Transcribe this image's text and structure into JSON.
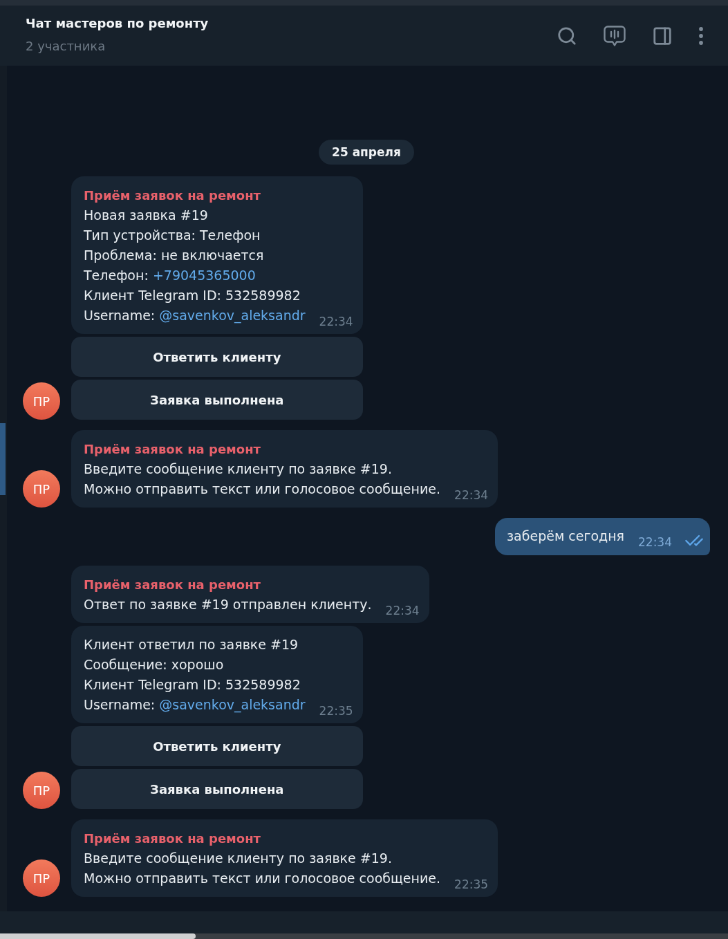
{
  "header": {
    "title": "Чат мастеров по ремонту",
    "subtitle": "2 участника"
  },
  "date": "25 апреля",
  "messages": [
    {
      "kind": "incoming",
      "sender": "Приём заявок на ремонт",
      "lines": [
        {
          "text": "Новая заявка #19"
        },
        {
          "text": "Тип устройства: Телефон"
        },
        {
          "text": "Проблема: не включается"
        },
        {
          "text": "Телефон: ",
          "link": "+79045365000"
        },
        {
          "text": "Клиент Telegram ID: 532589982"
        },
        {
          "text": "Username: ",
          "link": "@savenkov_aleksandr"
        }
      ],
      "time": "22:34",
      "buttons": [
        "Ответить клиенту",
        "Заявка выполнена"
      ],
      "avatar": "ПР"
    },
    {
      "kind": "incoming",
      "sender": "Приём заявок на ремонт",
      "lines": [
        {
          "text": "Введите сообщение клиенту по заявке #19."
        },
        {
          "text": "Можно отправить текст или голосовое сообщение."
        }
      ],
      "time": "22:34",
      "avatar": "ПР"
    },
    {
      "kind": "outgoing",
      "text": "заберём сегодня",
      "time": "22:34",
      "read": true
    },
    {
      "kind": "incoming",
      "sender": "Приём заявок на ремонт",
      "lines": [
        {
          "text": "Ответ по заявке #19 отправлен клиенту."
        }
      ],
      "time": "22:34"
    },
    {
      "kind": "incoming",
      "lines": [
        {
          "text": "Клиент ответил по заявке #19"
        },
        {
          "text": "Сообщение: хорошо"
        },
        {
          "text": "Клиент Telegram ID: 532589982"
        },
        {
          "text": "Username: ",
          "link": "@savenkov_aleksandr"
        }
      ],
      "time": "22:35",
      "buttons": [
        "Ответить клиенту",
        "Заявка выполнена"
      ],
      "avatar": "ПР"
    },
    {
      "kind": "incoming",
      "sender": "Приём заявок на ремонт",
      "lines": [
        {
          "text": "Введите сообщение клиенту по заявке #19."
        },
        {
          "text": "Можно отправить текст или голосовое сообщение."
        }
      ],
      "time": "22:35",
      "avatar": "ПР"
    }
  ]
}
